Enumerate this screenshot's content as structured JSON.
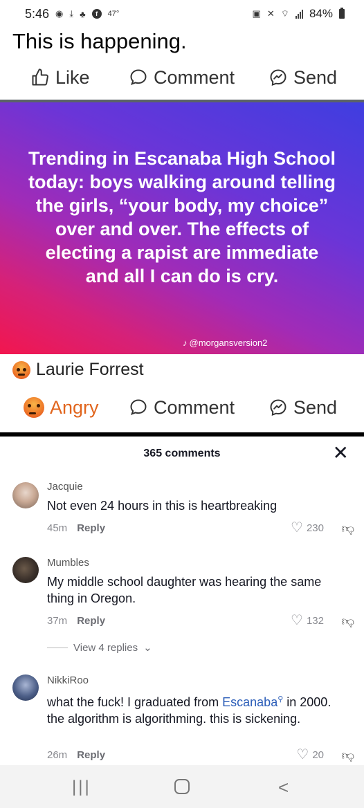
{
  "status_bar": {
    "time": "5:46",
    "temperature": "47°",
    "battery": "84%",
    "icons": [
      "location-icon",
      "download-icon",
      "person-icon",
      "app-icon",
      "lock-icon",
      "mute-icon",
      "wifi-icon",
      "signal-icon",
      "battery-icon"
    ]
  },
  "post": {
    "text": "This is happening.",
    "actions": {
      "like": "Like",
      "comment": "Comment",
      "send": "Send"
    }
  },
  "image": {
    "text": "Trending in Escanaba High School today: boys walking around telling the girls, “your body, my choice” over and over. The effects of electing a rapist are immediate and all I can do is cry.",
    "tiktok_handle": "@morgansversion2",
    "colors": {
      "top": "#3f3ee0",
      "bottom": "#f2164e"
    }
  },
  "repost": {
    "owner": "Laurie Forrest",
    "actions": {
      "angry": "Angry",
      "comment": "Comment",
      "send": "Send"
    },
    "angry_color": "#e1651d"
  },
  "comments_sheet": {
    "title": "365 comments",
    "close_glyph": "✕",
    "comments": [
      {
        "user": "Jacquie",
        "text": "Not even 24 hours in this is heartbreaking",
        "time": "45m",
        "reply": "Reply",
        "likes": "230"
      },
      {
        "user": "Mumbles",
        "text": "My middle school daughter was hearing the same thing in Oregon.",
        "time": "37m",
        "reply": "Reply",
        "likes": "132",
        "view_replies": "View 4 replies"
      },
      {
        "user": "NikkiRoo",
        "text_before": "what the fuck! I graduated from ",
        "link": "Escanaba",
        "text_after": " in 2000. the algorithm is algorithming. this is sickening.",
        "time": "26m",
        "reply": "Reply",
        "likes": "20"
      }
    ],
    "link_color": "#2b5db8"
  },
  "nav": {
    "recent": "|||",
    "home": "",
    "back": "<"
  }
}
